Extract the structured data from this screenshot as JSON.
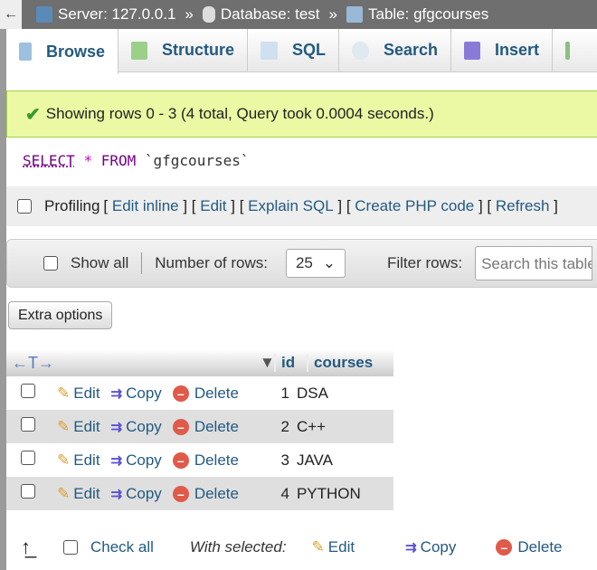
{
  "breadcrumb": {
    "back": "←",
    "server": "Server: 127.0.0.1",
    "database": "Database: test",
    "table": "Table: gfgcourses",
    "separator": "»"
  },
  "tabs": [
    {
      "label": "Browse"
    },
    {
      "label": "Structure"
    },
    {
      "label": "SQL"
    },
    {
      "label": "Search"
    },
    {
      "label": "Insert"
    }
  ],
  "message": "Showing rows 0 - 3 (4 total, Query took 0.0004 seconds.)",
  "query": {
    "select": "SELECT",
    "star": "*",
    "from": "FROM",
    "table": "`gfgcourses`"
  },
  "profiling": {
    "label": "Profiling",
    "links": [
      "Edit inline",
      "Edit",
      "Explain SQL",
      "Create PHP code",
      "Refresh"
    ]
  },
  "nav": {
    "show_all": "Show all",
    "rows_label": "Number of rows:",
    "rows_value": "25",
    "filter_label": "Filter rows:",
    "filter_placeholder": "Search this table"
  },
  "extra_options": "Extra options",
  "table": {
    "arrows": "←T→",
    "columns": [
      "id",
      "courses"
    ],
    "actions": {
      "edit": "Edit",
      "copy": "Copy",
      "delete": "Delete"
    },
    "rows": [
      {
        "id": "1",
        "courses": "DSA"
      },
      {
        "id": "2",
        "courses": "C++"
      },
      {
        "id": "3",
        "courses": "JAVA"
      },
      {
        "id": "4",
        "courses": "PYTHON"
      }
    ]
  },
  "footer": {
    "check_all": "Check all",
    "with_selected": "With selected:",
    "edit": "Edit",
    "copy": "Copy",
    "delete": "Delete"
  }
}
